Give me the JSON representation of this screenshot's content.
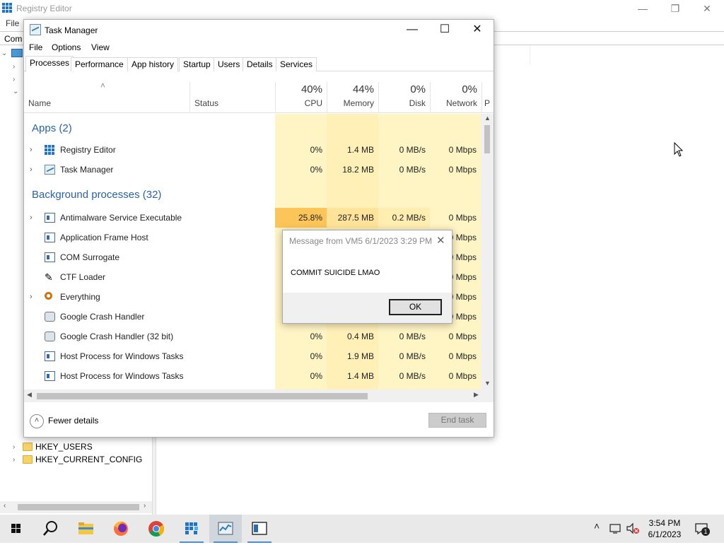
{
  "registry": {
    "title": "Registry Editor",
    "menu_file": "File",
    "address": "Com",
    "tree": [
      {
        "label": "HKEY_USERS"
      },
      {
        "label": "HKEY_CURRENT_CONFIG"
      }
    ]
  },
  "task_manager": {
    "title": "Task Manager",
    "menu": [
      "File",
      "Options",
      "View"
    ],
    "tabs": [
      "Processes",
      "Performance",
      "App history",
      "Startup",
      "Users",
      "Details",
      "Services"
    ],
    "active_tab": "Processes",
    "columns": {
      "name": "Name",
      "status": "Status",
      "cpu": {
        "label": "CPU",
        "pct": "40%"
      },
      "memory": {
        "label": "Memory",
        "pct": "44%"
      },
      "disk": {
        "label": "Disk",
        "pct": "0%"
      },
      "network": {
        "label": "Network",
        "pct": "0%"
      },
      "power": "P"
    },
    "sections": {
      "apps": "Apps (2)",
      "background": "Background processes (32)"
    },
    "apps": [
      {
        "name": "Registry Editor",
        "cpu": "0%",
        "memory": "1.4 MB",
        "disk": "0 MB/s",
        "network": "0 Mbps"
      },
      {
        "name": "Task Manager",
        "cpu": "0%",
        "memory": "18.2 MB",
        "disk": "0 MB/s",
        "network": "0 Mbps"
      }
    ],
    "background": [
      {
        "name": "Antimalware Service Executable",
        "cpu": "25.8%",
        "memory": "287.5 MB",
        "disk": "0.2 MB/s",
        "network": "0 Mbps"
      },
      {
        "name": "Application Frame Host",
        "cpu": "",
        "memory": "",
        "disk": "",
        "network": "0 Mbps"
      },
      {
        "name": "COM Surrogate",
        "cpu": "",
        "memory": "",
        "disk": "",
        "network": "0 Mbps"
      },
      {
        "name": "CTF Loader",
        "cpu": "",
        "memory": "",
        "disk": "",
        "network": "0 Mbps"
      },
      {
        "name": "Everything",
        "cpu": "",
        "memory": "",
        "disk": "",
        "network": "0 Mbps"
      },
      {
        "name": "Google Crash Handler",
        "cpu": "",
        "memory": "",
        "disk": "",
        "network": "0 Mbps"
      },
      {
        "name": "Google Crash Handler (32 bit)",
        "cpu": "0%",
        "memory": "0.4 MB",
        "disk": "0 MB/s",
        "network": "0 Mbps"
      },
      {
        "name": "Host Process for Windows Tasks",
        "cpu": "0%",
        "memory": "1.9 MB",
        "disk": "0 MB/s",
        "network": "0 Mbps"
      },
      {
        "name": "Host Process for Windows Tasks",
        "cpu": "0%",
        "memory": "1.4 MB",
        "disk": "0 MB/s",
        "network": "0 Mbps"
      }
    ],
    "fewer_details": "Fewer details",
    "end_task": "End task"
  },
  "message_box": {
    "title": "Message from VM5 6/1/2023 3:29 PM",
    "body": "COMMIT SUICIDE LMAO",
    "ok": "OK"
  },
  "taskbar": {
    "time": "3:54 PM",
    "date": "6/1/2023",
    "notifications": "1"
  },
  "colors": {
    "accent": "#2b63a8",
    "cpu_high": "#fcc55a",
    "heat_low": "#fff4c4"
  }
}
